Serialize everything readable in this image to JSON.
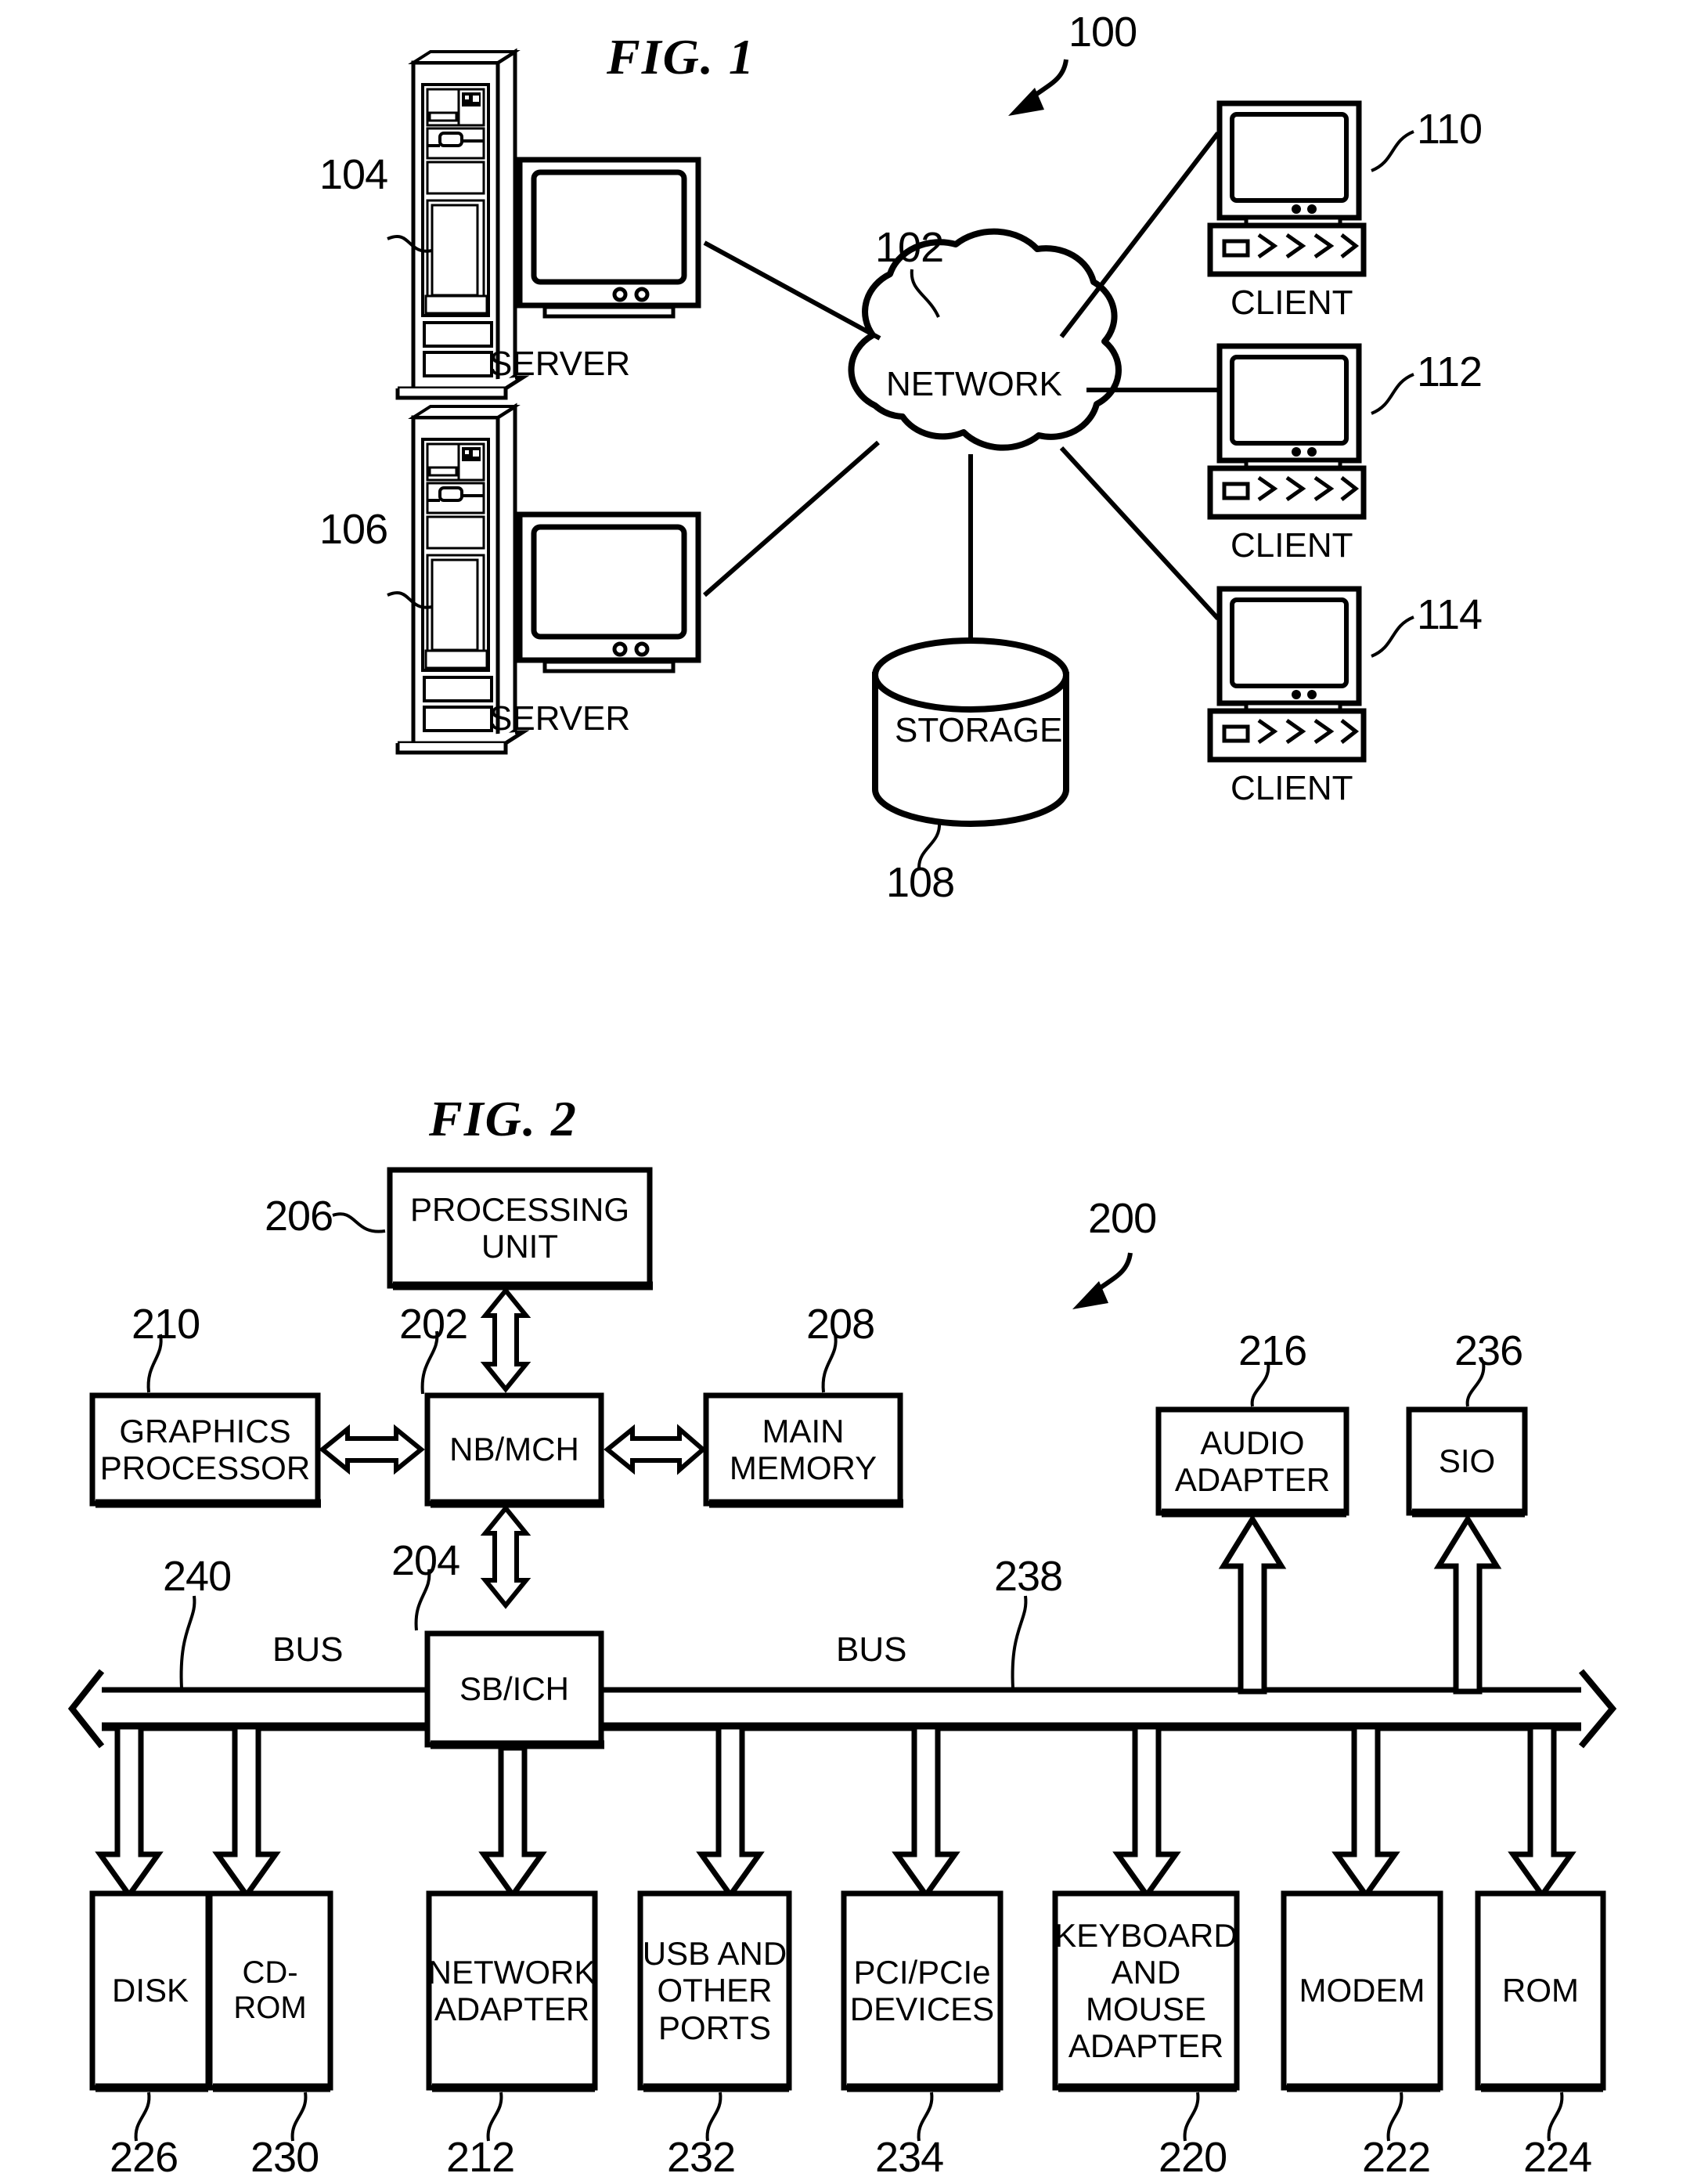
{
  "figures": [
    {
      "id": "fig1",
      "title": "FIG. 1",
      "system_ref": "100",
      "nodes": [
        {
          "name": "server-top",
          "label": "SERVER",
          "ref": "104"
        },
        {
          "name": "server-bottom",
          "label": "SERVER",
          "ref": "106"
        },
        {
          "name": "network-cloud",
          "label": "NETWORK",
          "ref": "102"
        },
        {
          "name": "storage",
          "label": "STORAGE",
          "ref": "108"
        },
        {
          "name": "client-1",
          "label": "CLIENT",
          "ref": "110"
        },
        {
          "name": "client-2",
          "label": "CLIENT",
          "ref": "112"
        },
        {
          "name": "client-3",
          "label": "CLIENT",
          "ref": "114"
        }
      ]
    },
    {
      "id": "fig2",
      "title": "FIG. 2",
      "system_ref": "200",
      "blocks": [
        {
          "name": "processing-unit",
          "label": "PROCESSING\nUNIT",
          "ref": "206"
        },
        {
          "name": "nb-mch",
          "label": "NB/MCH",
          "ref": "202"
        },
        {
          "name": "graphics-processor",
          "label": "GRAPHICS\nPROCESSOR",
          "ref": "210"
        },
        {
          "name": "main-memory",
          "label": "MAIN\nMEMORY",
          "ref": "208"
        },
        {
          "name": "audio-adapter",
          "label": "AUDIO\nADAPTER",
          "ref": "216"
        },
        {
          "name": "sio",
          "label": "SIO",
          "ref": "236"
        },
        {
          "name": "sb-ich",
          "label": "SB/ICH",
          "ref": "204"
        },
        {
          "name": "disk",
          "label": "DISK",
          "ref": "226"
        },
        {
          "name": "cd-rom",
          "label": "CD-ROM",
          "ref": "230"
        },
        {
          "name": "network-adapter",
          "label": "NETWORK\nADAPTER",
          "ref": "212"
        },
        {
          "name": "usb-other-ports",
          "label": "USB AND\nOTHER\nPORTS",
          "ref": "232"
        },
        {
          "name": "pci-pcie-devices",
          "label": "PCI/PCIe\nDEVICES",
          "ref": "234"
        },
        {
          "name": "keyboard-mouse-adapter",
          "label": "KEYBOARD\nAND\nMOUSE\nADAPTER",
          "ref": "220"
        },
        {
          "name": "modem",
          "label": "MODEM",
          "ref": "222"
        },
        {
          "name": "rom",
          "label": "ROM",
          "ref": "224"
        }
      ],
      "buses": [
        {
          "name": "bus-left",
          "label": "BUS",
          "ref": "240"
        },
        {
          "name": "bus-right",
          "label": "BUS",
          "ref": "238"
        }
      ]
    }
  ],
  "fig1": {
    "title": "FIG. 1",
    "system_ref": "100",
    "server_top": {
      "label": "SERVER",
      "ref": "104"
    },
    "server_bottom": {
      "label": "SERVER",
      "ref": "106"
    },
    "network": {
      "label": "NETWORK",
      "ref": "102"
    },
    "storage": {
      "label": "STORAGE",
      "ref": "108"
    },
    "client1": {
      "label": "CLIENT",
      "ref": "110"
    },
    "client2": {
      "label": "CLIENT",
      "ref": "112"
    },
    "client3": {
      "label": "CLIENT",
      "ref": "114"
    }
  },
  "fig2": {
    "title": "FIG. 2",
    "system_ref": "200",
    "processing_unit": {
      "line1": "PROCESSING",
      "line2": "UNIT",
      "ref": "206"
    },
    "nbmch": {
      "label": "NB/MCH",
      "ref": "202"
    },
    "graphics_processor": {
      "line1": "GRAPHICS",
      "line2": "PROCESSOR",
      "ref": "210"
    },
    "main_memory": {
      "line1": "MAIN",
      "line2": "MEMORY",
      "ref": "208"
    },
    "audio_adapter": {
      "line1": "AUDIO",
      "line2": "ADAPTER",
      "ref": "216"
    },
    "sio": {
      "label": "SIO",
      "ref": "236"
    },
    "sbich": {
      "label": "SB/ICH",
      "ref": "204"
    },
    "bus_left": {
      "label": "BUS",
      "ref": "240"
    },
    "bus_right": {
      "label": "BUS",
      "ref": "238"
    },
    "disk": {
      "label": "DISK",
      "ref": "226"
    },
    "cdrom": {
      "label": "CD-ROM",
      "ref": "230"
    },
    "network_adapter": {
      "line1": "NETWORK",
      "line2": "ADAPTER",
      "ref": "212"
    },
    "usb_ports": {
      "line1": "USB AND",
      "line2": "OTHER",
      "line3": "PORTS",
      "ref": "232"
    },
    "pci_devices": {
      "line1": "PCI/PCIe",
      "line2": "DEVICES",
      "ref": "234"
    },
    "keyboard_mouse": {
      "line1": "KEYBOARD",
      "line2": "AND",
      "line3": "MOUSE",
      "line4": "ADAPTER",
      "ref": "220"
    },
    "modem": {
      "label": "MODEM",
      "ref": "222"
    },
    "rom": {
      "label": "ROM",
      "ref": "224"
    }
  },
  "colors": {
    "ink": "#000000",
    "paper": "#ffffff"
  }
}
